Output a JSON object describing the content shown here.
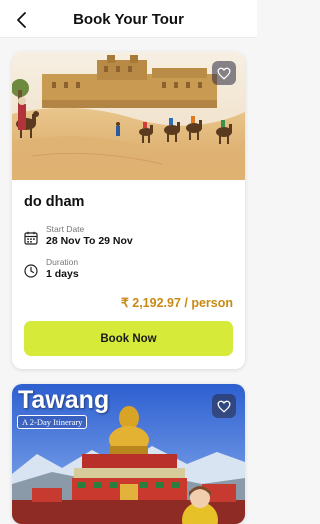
{
  "header": {
    "title": "Book Your Tour"
  },
  "tours": [
    {
      "name": "do dham",
      "start_date_label": "Start Date",
      "start_date_value": "28 Nov To 29 Nov",
      "duration_label": "Duration",
      "duration_value": "1 days",
      "price": "₹ 2,192.97 / person",
      "book_label": "Book Now"
    },
    {
      "image_title": "Tawang",
      "image_subtitle": "A 2-Day Itinerary"
    }
  ],
  "colors": {
    "accent_button": "#d6ea3a",
    "price": "#c98a14"
  }
}
